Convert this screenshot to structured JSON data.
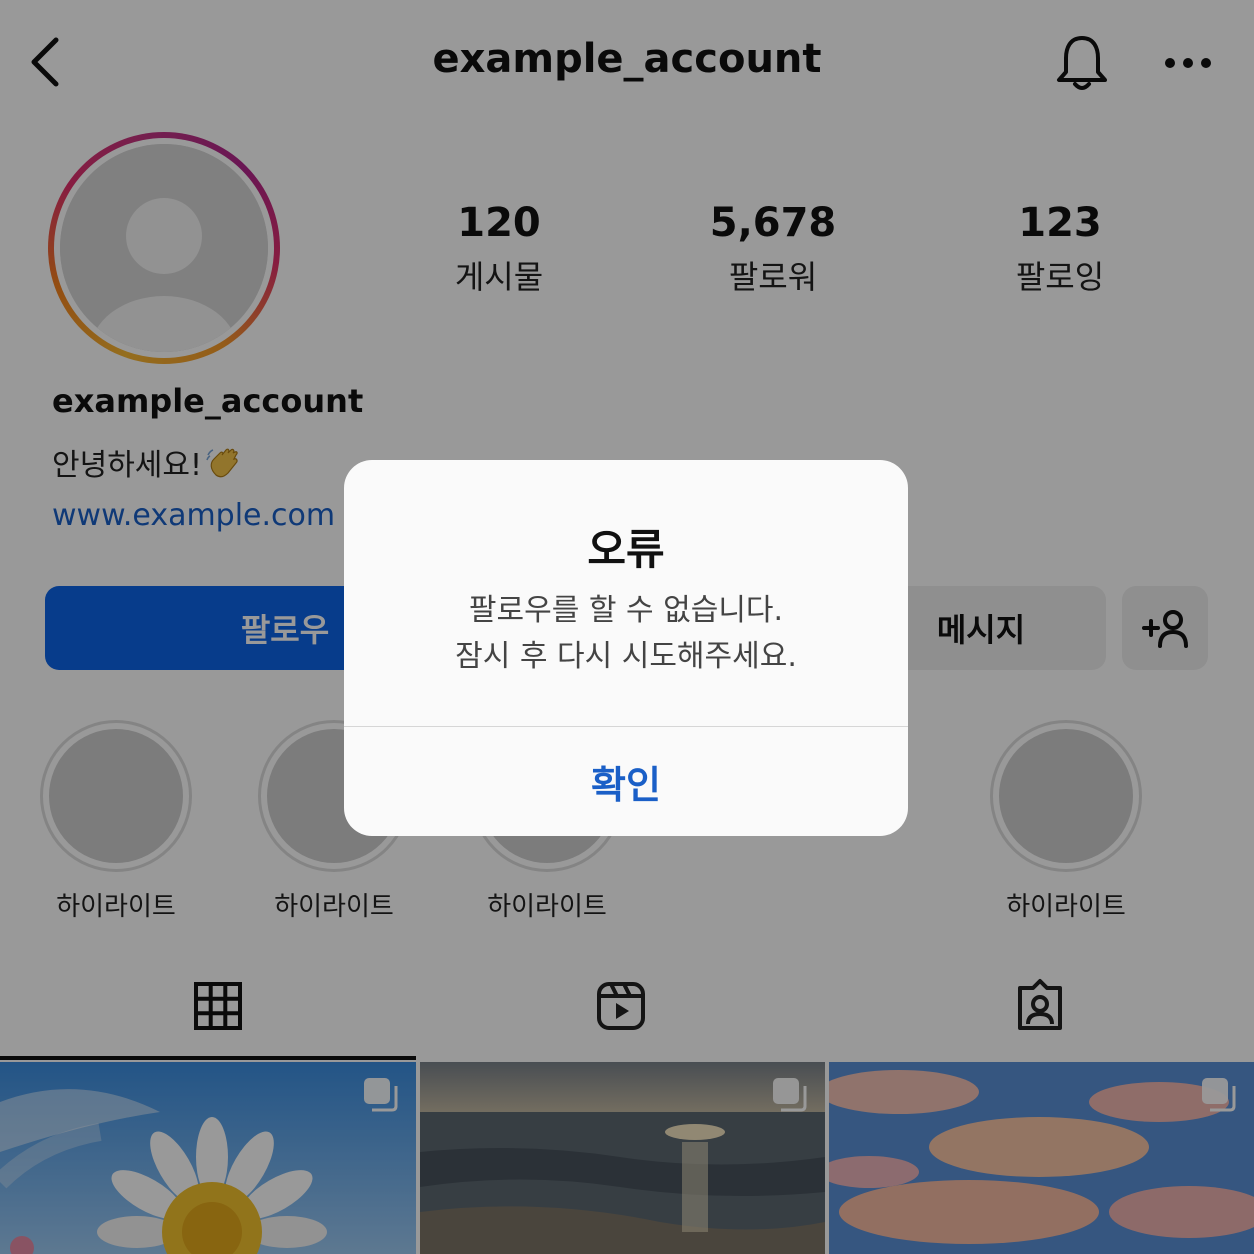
{
  "header": {
    "title": "example_account",
    "back_icon": "chevron-left-icon",
    "bell_icon": "bell-icon",
    "more_icon": "more-horizontal-icon"
  },
  "profile": {
    "username": "example_account",
    "bio": "안녕하세요!",
    "bio_emoji": "waving-hand-emoji",
    "link": "www.example.com",
    "avatar_icon": "default-avatar-icon",
    "stats": [
      {
        "value": "120",
        "label": "게시물"
      },
      {
        "value": "5,678",
        "label": "팔로워"
      },
      {
        "value": "123",
        "label": "팔로잉"
      }
    ]
  },
  "actions": {
    "follow_label": "팔로우",
    "message_label": "메시지",
    "add_user_icon": "add-person-icon",
    "follow_color": "#0d64e8"
  },
  "highlights": [
    {
      "label": "하이라이트"
    },
    {
      "label": "하이라이트"
    },
    {
      "label": "하이라이트"
    },
    {
      "label": "하이라이트"
    }
  ],
  "tabs": [
    {
      "icon": "grid-icon",
      "active": true
    },
    {
      "icon": "reels-icon",
      "active": false
    },
    {
      "icon": "tagged-icon",
      "active": false
    }
  ],
  "posts": [
    {
      "subject": "daisy flower against blue sky",
      "multi_icon": "carousel-icon"
    },
    {
      "subject": "sunset over ocean shore",
      "multi_icon": "carousel-icon"
    },
    {
      "subject": "pink clouds in blue sky",
      "multi_icon": "carousel-icon"
    }
  ],
  "dialog": {
    "title": "오류",
    "message_line1": "팔로우를 할 수 없습니다.",
    "message_line2": "잠시 후 다시 시도해주세요.",
    "confirm_label": "확인",
    "accent": "#1a5fc7"
  }
}
